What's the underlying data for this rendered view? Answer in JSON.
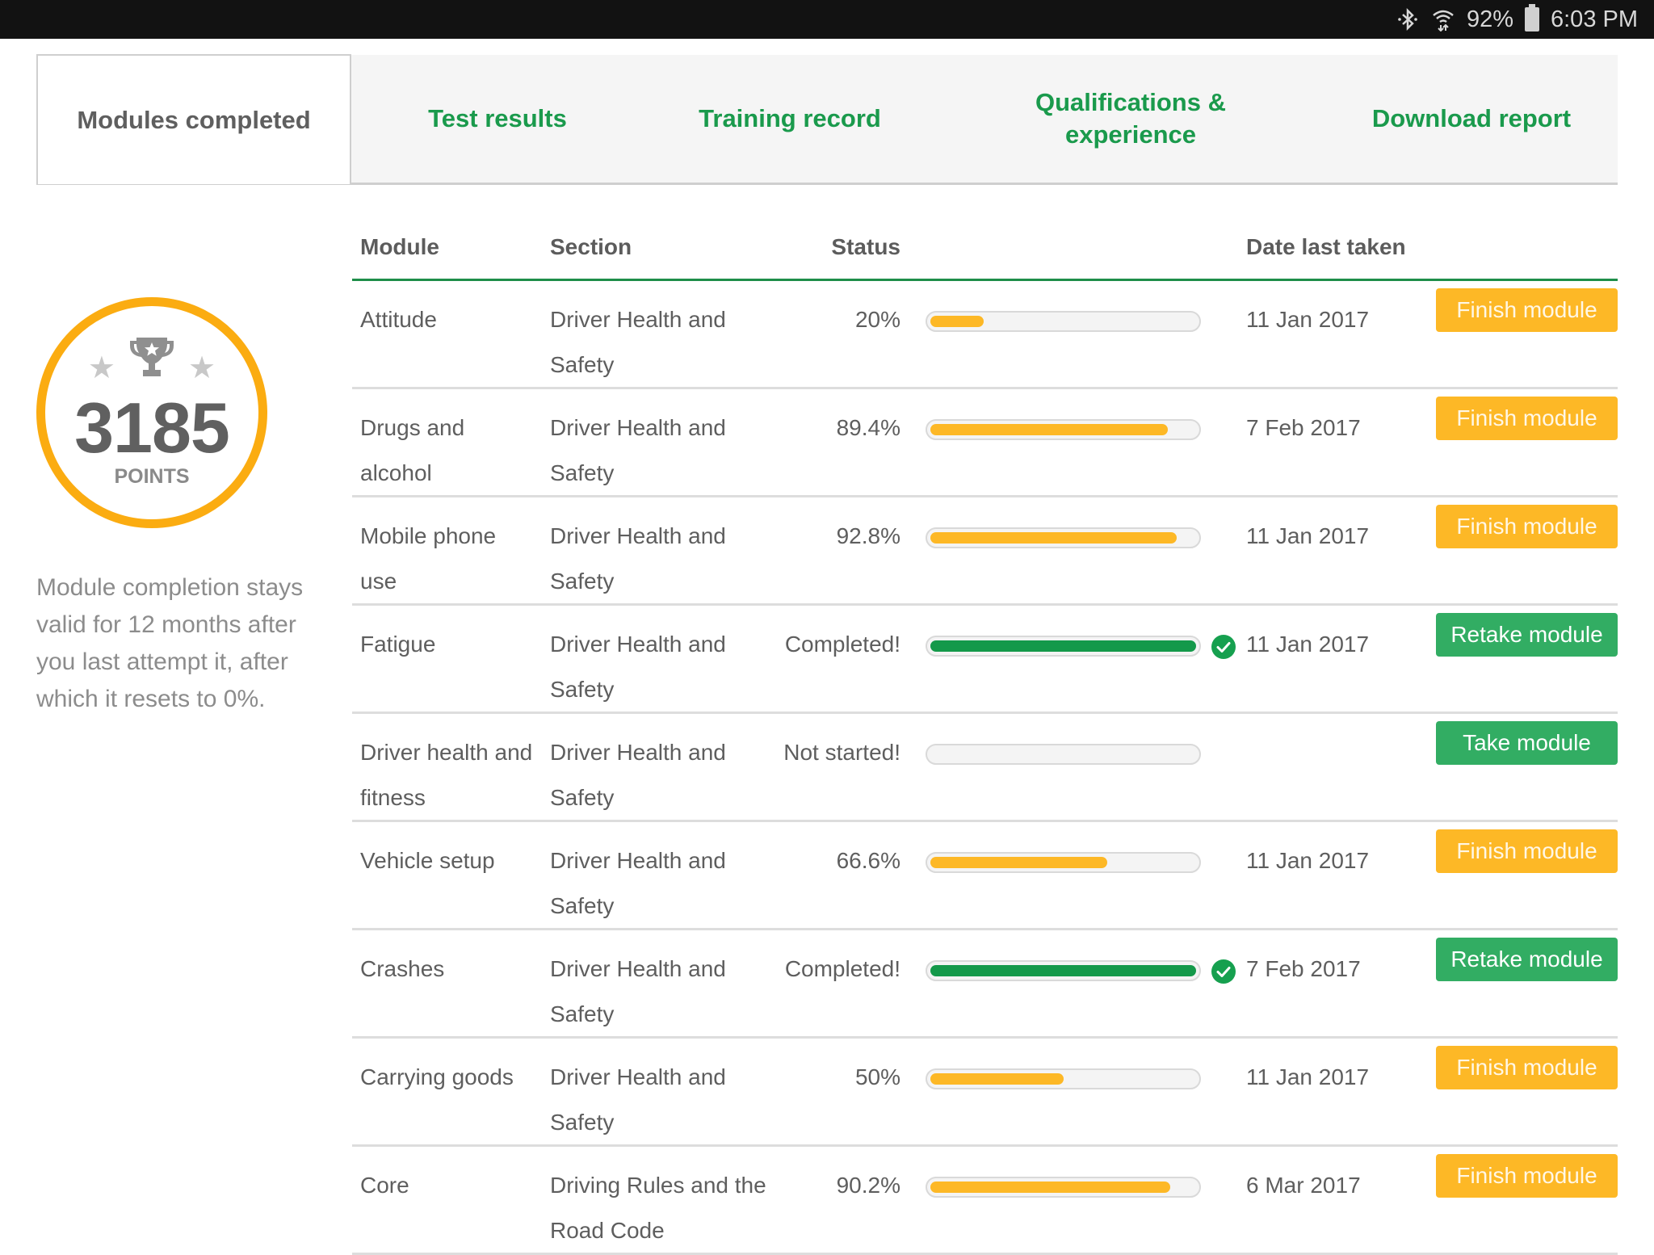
{
  "status_bar": {
    "icons": [
      "bluetooth-icon",
      "wifi-icon"
    ],
    "battery_percent": "92%",
    "time": "6:03 PM"
  },
  "tabs": [
    {
      "label": "Modules completed",
      "active": true
    },
    {
      "label": "Test results",
      "active": false
    },
    {
      "label": "Training record",
      "active": false
    },
    {
      "label": "Qualifications & experience",
      "active": false
    },
    {
      "label": "Download report",
      "active": false
    }
  ],
  "sidebar": {
    "points_value": "3185",
    "points_label": "POINTS",
    "note": "Module completion stays valid for 12 months after you last attempt it, after which it resets to 0%."
  },
  "table": {
    "headers": {
      "module": "Module",
      "section": "Section",
      "status": "Status",
      "date": "Date last taken"
    },
    "rows": [
      {
        "module": "Attitude",
        "section": "Driver Health and Safety",
        "status": "20%",
        "progress": 20,
        "completed": false,
        "date": "11 Jan 2017",
        "action": "Finish module",
        "action_type": "finish"
      },
      {
        "module": "Drugs and alcohol",
        "section": "Driver Health and Safety",
        "status": "89.4%",
        "progress": 89.4,
        "completed": false,
        "date": "7 Feb 2017",
        "action": "Finish module",
        "action_type": "finish"
      },
      {
        "module": "Mobile phone use",
        "section": "Driver Health and Safety",
        "status": "92.8%",
        "progress": 92.8,
        "completed": false,
        "date": "11 Jan 2017",
        "action": "Finish module",
        "action_type": "finish"
      },
      {
        "module": "Fatigue",
        "section": "Driver Health and Safety",
        "status": "Completed!",
        "progress": 100,
        "completed": true,
        "date": "11 Jan 2017",
        "action": "Retake module",
        "action_type": "retake"
      },
      {
        "module": "Driver health and fitness",
        "section": "Driver Health and Safety",
        "status": "Not started!",
        "progress": 0,
        "completed": false,
        "date": "",
        "action": "Take module",
        "action_type": "retake"
      },
      {
        "module": "Vehicle setup",
        "section": "Driver Health and Safety",
        "status": "66.6%",
        "progress": 66.6,
        "completed": false,
        "date": "11 Jan 2017",
        "action": "Finish module",
        "action_type": "finish"
      },
      {
        "module": "Crashes",
        "section": "Driver Health and Safety",
        "status": "Completed!",
        "progress": 100,
        "completed": true,
        "date": "7 Feb 2017",
        "action": "Retake module",
        "action_type": "retake"
      },
      {
        "module": "Carrying goods",
        "section": "Driver Health and Safety",
        "status": "50%",
        "progress": 50,
        "completed": false,
        "date": "11 Jan 2017",
        "action": "Finish module",
        "action_type": "finish"
      },
      {
        "module": "Core",
        "section": "Driving Rules and the Road Code",
        "status": "90.2%",
        "progress": 90.2,
        "completed": false,
        "date": "6 Mar 2017",
        "action": "Finish module",
        "action_type": "finish"
      }
    ]
  },
  "colors": {
    "brand_green": "#1a9a4c",
    "progress_yellow": "#fdb826",
    "progress_green": "#14994a",
    "ring_orange": "#fbac11"
  }
}
